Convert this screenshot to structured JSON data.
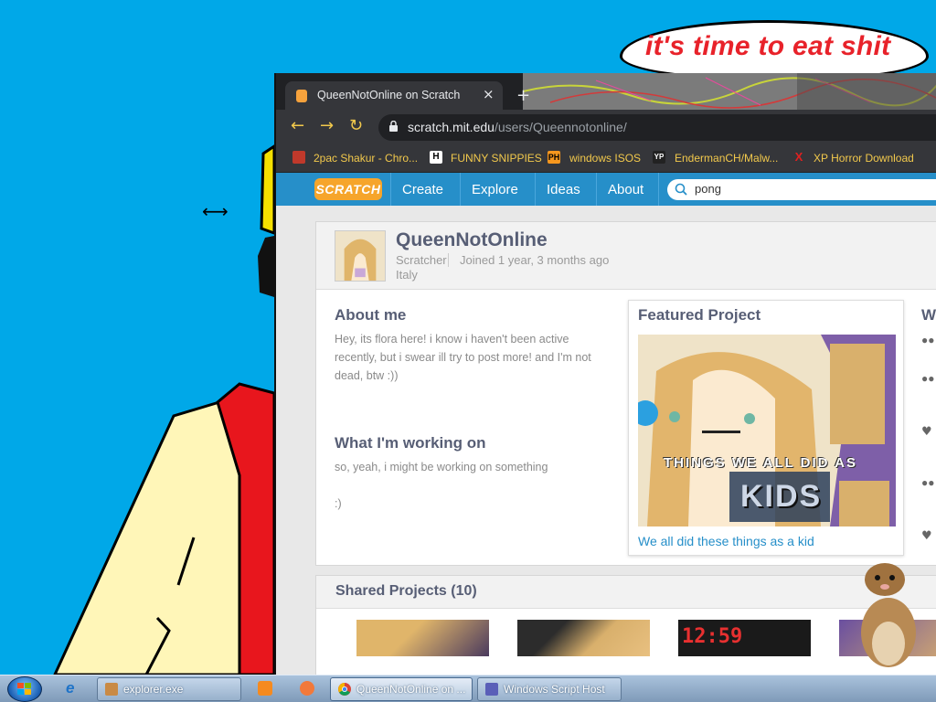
{
  "wallpaper": {
    "speech_bubble_text": "it's time to eat shit",
    "background_color": "#00a8e8"
  },
  "browser": {
    "tab": {
      "title": "QueenNotOnline on Scratch",
      "close_icon": "×",
      "new_tab_icon": "+"
    },
    "toolbar": {
      "back_icon": "←",
      "forward_icon": "→",
      "reload_icon": "↻",
      "url_host": "scratch.mit.edu",
      "url_path": "/users/Queennotonline/"
    },
    "bookmarks": [
      {
        "label": "2pac Shakur - Chro...",
        "icon": "gift-icon",
        "icon_text": "",
        "icon_bg": "#c0392b"
      },
      {
        "label": "FUNNY SNIPPIES",
        "icon": "h-icon",
        "icon_text": "H",
        "icon_bg": "#ffffff"
      },
      {
        "label": "windows ISOS",
        "icon": "ph-icon",
        "icon_text": "PH",
        "icon_bg": "#f7971e"
      },
      {
        "label": "EndermanCH/Malw...",
        "icon": "yp-icon",
        "icon_text": "YP",
        "icon_bg": "#222222"
      },
      {
        "label": "XP Horror Download",
        "icon": "x-icon",
        "icon_text": "X",
        "icon_bg": "#35363a"
      }
    ]
  },
  "scratch": {
    "logo": "SCRATCH",
    "nav": [
      "Create",
      "Explore",
      "Ideas",
      "About"
    ],
    "search": {
      "value": "pong"
    },
    "profile": {
      "username": "QueenNotOnline",
      "role": "Scratcher",
      "joined": "Joined 1 year, 3 months ago",
      "location": "Italy"
    },
    "about_me": {
      "title": "About me",
      "text": "Hey, its flora here! i know i haven't been active recently, but i swear ill try to post more! and I'm not dead, btw :))"
    },
    "working_on": {
      "title": "What I'm working on",
      "line1": "so, yeah, i might be working on something",
      "line2": ":)"
    },
    "featured": {
      "title": "Featured Project",
      "thumbnail_text_top": "THINGS WE ALL DID AS",
      "thumbnail_text_big": "KIDS",
      "caption": "We all did these things as a kid"
    },
    "right_column_heading": "W",
    "shared": {
      "title": "Shared Projects (10)",
      "thumb_text_3": "12:59"
    }
  },
  "taskbar": {
    "tasks": [
      {
        "label": "explorer.exe",
        "icon": "explorer-icon"
      },
      {
        "label": "QueenNotOnline on ...",
        "icon": "chrome-icon",
        "active": true
      },
      {
        "label": "Windows Script Host",
        "icon": "script-host-icon"
      }
    ],
    "colors": {
      "accent": "#268fc9",
      "scratch_orange": "#f6a52b"
    }
  }
}
